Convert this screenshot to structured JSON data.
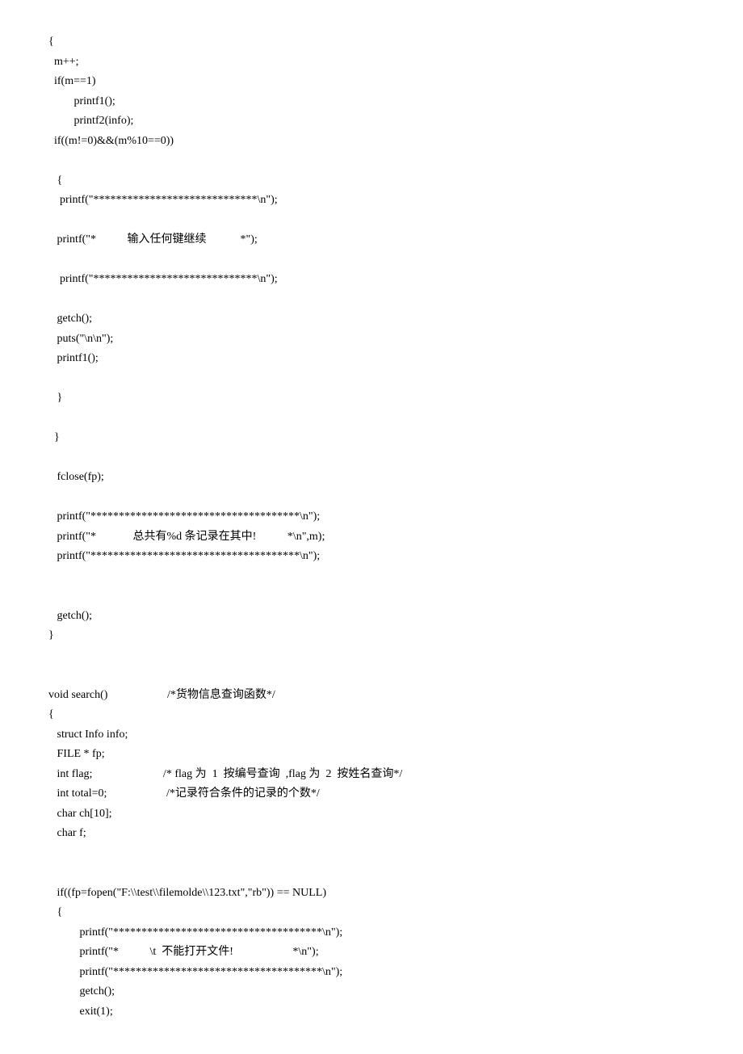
{
  "lines": [
    "{",
    "  m++;",
    "  if(m==1)",
    "         printf1();",
    "         printf2(info);",
    "  if((m!=0)&&(m%10==0))",
    "",
    "   {",
    "    printf(\"*****************************\\n\");",
    "",
    "   printf(\"*           输入任何键继续            *\");",
    "",
    "    printf(\"*****************************\\n\");",
    "",
    "   getch();",
    "   puts(\"\\n\\n\");",
    "   printf1();",
    "",
    "   }",
    "",
    "  }",
    "",
    "   fclose(fp);",
    "",
    "   printf(\"*************************************\\n\");",
    "   printf(\"*             总共有%d 条记录在其中!           *\\n\",m);",
    "   printf(\"*************************************\\n\");",
    "",
    "",
    "   getch();",
    "}",
    "",
    "",
    "void search()                     /*货物信息查询函数*/",
    "{",
    "   struct Info info;",
    "   FILE * fp;",
    "   int flag;                         /* flag 为  1  按编号查询  ,flag 为  2  按姓名查询*/",
    "   int total=0;                     /*记录符合条件的记录的个数*/",
    "   char ch[10];",
    "   char f;",
    "",
    "",
    "   if((fp=fopen(\"F:\\\\test\\\\filemolde\\\\123.txt\",\"rb\")) == NULL)",
    "   {",
    "           printf(\"*************************************\\n\");",
    "           printf(\"*           \\t  不能打开文件!                     *\\n\");",
    "           printf(\"*************************************\\n\");",
    "           getch();",
    "           exit(1);"
  ]
}
